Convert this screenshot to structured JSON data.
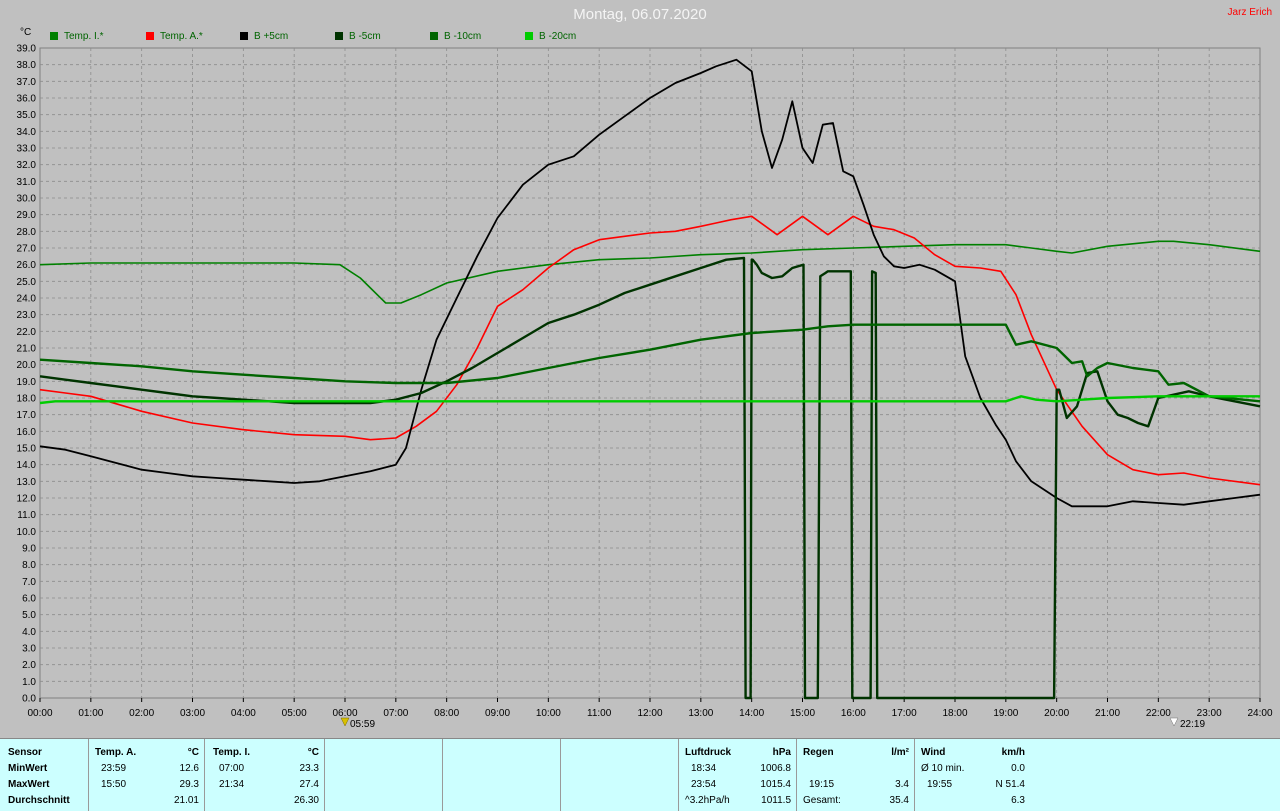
{
  "title": "Montag, 06.07.2020",
  "author": "Jarz Erich",
  "y_unit": "°C",
  "legend": [
    {
      "label": "Temp. I.*",
      "color": "#008000"
    },
    {
      "label": "Temp. A.*",
      "color": "#ff0000"
    },
    {
      "label": "B +5cm",
      "color": "#000000"
    },
    {
      "label": "B -5cm",
      "color": "#003300"
    },
    {
      "label": "B -10cm",
      "color": "#006400"
    },
    {
      "label": "B -20cm",
      "color": "#00cc00"
    }
  ],
  "markers": {
    "sunrise": "05:59",
    "sunset": "22:19"
  },
  "chart_data": {
    "type": "line",
    "xlabel": "",
    "ylabel": "°C",
    "xlim": [
      0,
      24
    ],
    "ylim": [
      0,
      39
    ],
    "grid": true,
    "legend_position": "top-left",
    "x_ticks": [
      "00:00",
      "01:00",
      "02:00",
      "03:00",
      "04:00",
      "05:00",
      "06:00",
      "07:00",
      "08:00",
      "09:00",
      "10:00",
      "11:00",
      "12:00",
      "13:00",
      "14:00",
      "15:00",
      "16:00",
      "17:00",
      "18:00",
      "19:00",
      "20:00",
      "21:00",
      "22:00",
      "23:00",
      "24:00"
    ],
    "y_ticks": [
      "0.0",
      "1.0",
      "2.0",
      "3.0",
      "4.0",
      "5.0",
      "6.0",
      "7.0",
      "8.0",
      "9.0",
      "10.0",
      "11.0",
      "12.0",
      "13.0",
      "14.0",
      "15.0",
      "16.0",
      "17.0",
      "18.0",
      "19.0",
      "20.0",
      "21.0",
      "22.0",
      "23.0",
      "24.0",
      "25.0",
      "26.0",
      "27.0",
      "28.0",
      "29.0",
      "30.0",
      "31.0",
      "32.0",
      "33.0",
      "34.0",
      "35.0",
      "36.0",
      "37.0",
      "38.0",
      "39.0"
    ],
    "series": [
      {
        "name": "Temp. I.*",
        "color": "#008000",
        "width": 1.6,
        "x": [
          0,
          1,
          2,
          3,
          4,
          5,
          5.9,
          6.3,
          6.8,
          7.1,
          7.5,
          8,
          9,
          10,
          11,
          12,
          13,
          14,
          15,
          16,
          17,
          18,
          19,
          19.5,
          20,
          20.3,
          21,
          22,
          22.3,
          23,
          24
        ],
        "y": [
          26.0,
          26.1,
          26.1,
          26.1,
          26.1,
          26.1,
          26.0,
          25.2,
          23.7,
          23.7,
          24.2,
          24.9,
          25.6,
          26.0,
          26.3,
          26.4,
          26.6,
          26.7,
          26.9,
          27.0,
          27.1,
          27.2,
          27.2,
          27.0,
          26.8,
          26.7,
          27.1,
          27.4,
          27.4,
          27.2,
          26.8
        ]
      },
      {
        "name": "Temp. A.*",
        "color": "#ff0000",
        "width": 1.6,
        "x": [
          0,
          0.5,
          1,
          2,
          3,
          4,
          5,
          6,
          6.5,
          7,
          7.4,
          7.8,
          8.2,
          8.6,
          9,
          9.5,
          10,
          10.5,
          11,
          11.5,
          12,
          12.5,
          13,
          13.3,
          13.6,
          14,
          14.5,
          15,
          15.5,
          16,
          16.4,
          16.8,
          17.2,
          17.6,
          18,
          18.5,
          18.9,
          19.2,
          19.5,
          20,
          20.5,
          21,
          21.5,
          22,
          22.5,
          23,
          24
        ],
        "y": [
          18.5,
          18.3,
          18.1,
          17.2,
          16.5,
          16.1,
          15.8,
          15.7,
          15.5,
          15.6,
          16.3,
          17.2,
          18.8,
          21.0,
          23.5,
          24.5,
          25.8,
          26.9,
          27.5,
          27.7,
          27.9,
          28.0,
          28.3,
          28.5,
          28.7,
          28.9,
          27.8,
          28.9,
          27.8,
          28.9,
          28.3,
          28.1,
          27.6,
          26.6,
          25.9,
          25.8,
          25.6,
          24.2,
          21.8,
          18.5,
          16.3,
          14.6,
          13.7,
          13.4,
          13.5,
          13.2,
          12.8
        ]
      },
      {
        "name": "B +5cm",
        "color": "#000000",
        "width": 1.8,
        "x": [
          0,
          0.5,
          1,
          1.5,
          2,
          2.5,
          3,
          3.5,
          4,
          4.5,
          5,
          5.5,
          6,
          6.5,
          7,
          7.2,
          7.5,
          7.8,
          8.2,
          8.6,
          9,
          9.5,
          10,
          10.5,
          11,
          11.5,
          12,
          12.5,
          13,
          13.3,
          13.7,
          14,
          14.2,
          14.4,
          14.6,
          14.8,
          15,
          15.2,
          15.4,
          15.6,
          15.8,
          16,
          16.2,
          16.4,
          16.6,
          16.8,
          17,
          17.3,
          17.6,
          18,
          18.2,
          18.5,
          18.8,
          19,
          19.2,
          19.5,
          20,
          20.3,
          20.6,
          21,
          21.5,
          22,
          22.5,
          23,
          23.5,
          24
        ],
        "y": [
          15.1,
          14.9,
          14.5,
          14.1,
          13.7,
          13.5,
          13.3,
          13.2,
          13.1,
          13.0,
          12.9,
          13.0,
          13.3,
          13.6,
          14.0,
          15.0,
          18.5,
          21.5,
          24.0,
          26.5,
          28.8,
          30.8,
          32.0,
          32.5,
          33.8,
          34.9,
          36.0,
          36.9,
          37.5,
          37.9,
          38.3,
          37.6,
          34.0,
          31.8,
          33.5,
          35.8,
          33.0,
          32.1,
          34.4,
          34.5,
          31.6,
          31.3,
          29.6,
          27.8,
          26.5,
          25.9,
          25.8,
          26.0,
          25.7,
          25.0,
          20.5,
          18.0,
          16.4,
          15.5,
          14.2,
          13.0,
          12.0,
          11.5,
          11.5,
          11.5,
          11.8,
          11.7,
          11.6,
          11.8,
          12.0,
          12.2
        ]
      },
      {
        "name": "B -5cm",
        "color": "#003300",
        "width": 2.4,
        "x": [
          0,
          0.5,
          1,
          1.5,
          2,
          2.5,
          3,
          3.5,
          4,
          4.5,
          5,
          5.5,
          6,
          6.5,
          7,
          7.5,
          8,
          8.5,
          9,
          9.5,
          10,
          10.5,
          11,
          11.5,
          12,
          12.5,
          13,
          13.5,
          13.85,
          13.88,
          13.9,
          13.98,
          14.0,
          14.02,
          14.1,
          14.2,
          14.4,
          14.6,
          14.8,
          15.02,
          15.05,
          15.15,
          15.2,
          15.3,
          15.35,
          15.45,
          15.5,
          15.8,
          15.95,
          15.98,
          16.08,
          16.11,
          16.2,
          16.34,
          16.37,
          16.44,
          16.47,
          16.6,
          16.63,
          16.7,
          17,
          17.5,
          18,
          18.5,
          19,
          19.5,
          19.95,
          20.0,
          20.05,
          20.2,
          20.4,
          20.6,
          20.8,
          21,
          21.2,
          21.4,
          21.6,
          21.8,
          22,
          22.3,
          22.6,
          23,
          23.5,
          24
        ],
        "y": [
          19.3,
          19.1,
          18.9,
          18.7,
          18.5,
          18.3,
          18.1,
          18.0,
          17.9,
          17.8,
          17.7,
          17.7,
          17.7,
          17.7,
          17.9,
          18.3,
          19.0,
          19.8,
          20.7,
          21.6,
          22.5,
          23.0,
          23.6,
          24.3,
          24.8,
          25.3,
          25.8,
          26.3,
          26.4,
          0,
          0,
          0,
          26.3,
          26.3,
          26.0,
          25.5,
          25.2,
          25.3,
          25.8,
          26.0,
          0,
          0,
          0,
          0,
          25.3,
          25.5,
          25.6,
          25.6,
          25.6,
          0,
          0,
          0,
          0,
          0,
          25.6,
          25.5,
          0,
          0,
          0,
          0,
          0,
          0,
          0,
          0,
          0,
          0,
          0,
          18.5,
          18.5,
          16.8,
          17.5,
          19.5,
          19.6,
          17.8,
          17.0,
          16.8,
          16.5,
          16.3,
          18.0,
          18.2,
          18.4,
          18.1,
          17.8,
          17.5
        ]
      },
      {
        "name": "B -10cm",
        "color": "#006400",
        "width": 2.4,
        "x": [
          0,
          1,
          2,
          3,
          4,
          5,
          6,
          7,
          8,
          9,
          10,
          11,
          12,
          13,
          14,
          15,
          15.5,
          16,
          17,
          18,
          19,
          19.2,
          19.5,
          20,
          20.3,
          20.5,
          20.6,
          20.8,
          21,
          21.5,
          22,
          22.2,
          22.5,
          23,
          24
        ],
        "y": [
          20.3,
          20.1,
          19.9,
          19.6,
          19.4,
          19.2,
          19.0,
          18.9,
          18.9,
          19.2,
          19.8,
          20.4,
          20.9,
          21.5,
          21.9,
          22.1,
          22.3,
          22.4,
          22.4,
          22.4,
          22.4,
          21.2,
          21.4,
          21.0,
          20.1,
          20.2,
          19.3,
          19.8,
          20.1,
          19.8,
          19.6,
          18.8,
          18.9,
          18.1,
          17.8
        ]
      },
      {
        "name": "B -20cm",
        "color": "#00cc00",
        "width": 2.4,
        "x": [
          0,
          0.3,
          1,
          4,
          8,
          12,
          16,
          19,
          19.3,
          19.6,
          20,
          20.5,
          21,
          22,
          24
        ],
        "y": [
          17.7,
          17.8,
          17.8,
          17.8,
          17.8,
          17.8,
          17.8,
          17.8,
          18.1,
          17.9,
          17.8,
          17.9,
          18.0,
          18.1,
          18.1
        ]
      }
    ]
  },
  "stats": {
    "sensor": {
      "header": "Sensor",
      "rows": [
        "MinWert",
        "MaxWert",
        "Durchschnitt"
      ]
    },
    "temp_a": {
      "header": "Temp. A.",
      "unit": "°C",
      "rows": [
        [
          "23:59",
          "12.6"
        ],
        [
          "15:50",
          "29.3"
        ],
        [
          "",
          "21.01"
        ]
      ]
    },
    "temp_i": {
      "header": "Temp. I.",
      "unit": "°C",
      "rows": [
        [
          "07:00",
          "23.3"
        ],
        [
          "21:34",
          "27.4"
        ],
        [
          "",
          "26.30"
        ]
      ]
    },
    "luftdruck": {
      "header": "Luftdruck",
      "unit": "hPa",
      "rows": [
        [
          "18:34",
          "1006.8"
        ],
        [
          "23:54",
          "1015.4"
        ],
        [
          "^3.2hPa/h",
          "1011.5"
        ]
      ]
    },
    "regen": {
      "header": "Regen",
      "unit": "l/m²",
      "rows": [
        [
          "",
          ""
        ],
        [
          "19:15",
          "3.4"
        ],
        [
          "Gesamt:",
          "35.4"
        ]
      ]
    },
    "wind": {
      "header": "Wind",
      "unit": "km/h",
      "rows": [
        [
          "Ø 10 min.",
          "0.0"
        ],
        [
          "19:55",
          "N 51.4"
        ],
        [
          "",
          "6.3"
        ]
      ]
    }
  }
}
